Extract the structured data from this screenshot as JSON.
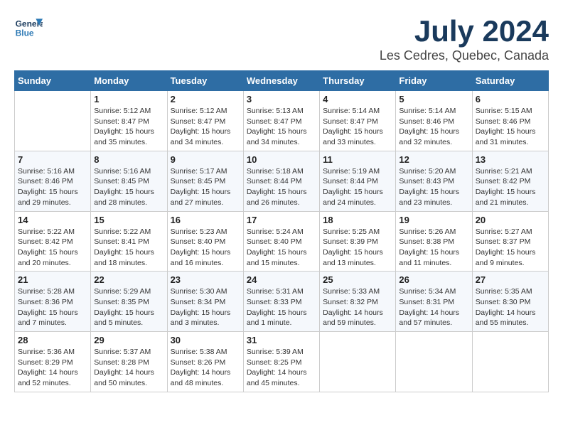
{
  "header": {
    "logo_line1": "General",
    "logo_line2": "Blue",
    "month_title": "July 2024",
    "location": "Les Cedres, Quebec, Canada"
  },
  "days_of_week": [
    "Sunday",
    "Monday",
    "Tuesday",
    "Wednesday",
    "Thursday",
    "Friday",
    "Saturday"
  ],
  "weeks": [
    [
      {
        "day": "",
        "sunrise": "",
        "sunset": "",
        "daylight": ""
      },
      {
        "day": "1",
        "sunrise": "Sunrise: 5:12 AM",
        "sunset": "Sunset: 8:47 PM",
        "daylight": "Daylight: 15 hours and 35 minutes."
      },
      {
        "day": "2",
        "sunrise": "Sunrise: 5:12 AM",
        "sunset": "Sunset: 8:47 PM",
        "daylight": "Daylight: 15 hours and 34 minutes."
      },
      {
        "day": "3",
        "sunrise": "Sunrise: 5:13 AM",
        "sunset": "Sunset: 8:47 PM",
        "daylight": "Daylight: 15 hours and 34 minutes."
      },
      {
        "day": "4",
        "sunrise": "Sunrise: 5:14 AM",
        "sunset": "Sunset: 8:47 PM",
        "daylight": "Daylight: 15 hours and 33 minutes."
      },
      {
        "day": "5",
        "sunrise": "Sunrise: 5:14 AM",
        "sunset": "Sunset: 8:46 PM",
        "daylight": "Daylight: 15 hours and 32 minutes."
      },
      {
        "day": "6",
        "sunrise": "Sunrise: 5:15 AM",
        "sunset": "Sunset: 8:46 PM",
        "daylight": "Daylight: 15 hours and 31 minutes."
      }
    ],
    [
      {
        "day": "7",
        "sunrise": "Sunrise: 5:16 AM",
        "sunset": "Sunset: 8:46 PM",
        "daylight": "Daylight: 15 hours and 29 minutes."
      },
      {
        "day": "8",
        "sunrise": "Sunrise: 5:16 AM",
        "sunset": "Sunset: 8:45 PM",
        "daylight": "Daylight: 15 hours and 28 minutes."
      },
      {
        "day": "9",
        "sunrise": "Sunrise: 5:17 AM",
        "sunset": "Sunset: 8:45 PM",
        "daylight": "Daylight: 15 hours and 27 minutes."
      },
      {
        "day": "10",
        "sunrise": "Sunrise: 5:18 AM",
        "sunset": "Sunset: 8:44 PM",
        "daylight": "Daylight: 15 hours and 26 minutes."
      },
      {
        "day": "11",
        "sunrise": "Sunrise: 5:19 AM",
        "sunset": "Sunset: 8:44 PM",
        "daylight": "Daylight: 15 hours and 24 minutes."
      },
      {
        "day": "12",
        "sunrise": "Sunrise: 5:20 AM",
        "sunset": "Sunset: 8:43 PM",
        "daylight": "Daylight: 15 hours and 23 minutes."
      },
      {
        "day": "13",
        "sunrise": "Sunrise: 5:21 AM",
        "sunset": "Sunset: 8:42 PM",
        "daylight": "Daylight: 15 hours and 21 minutes."
      }
    ],
    [
      {
        "day": "14",
        "sunrise": "Sunrise: 5:22 AM",
        "sunset": "Sunset: 8:42 PM",
        "daylight": "Daylight: 15 hours and 20 minutes."
      },
      {
        "day": "15",
        "sunrise": "Sunrise: 5:22 AM",
        "sunset": "Sunset: 8:41 PM",
        "daylight": "Daylight: 15 hours and 18 minutes."
      },
      {
        "day": "16",
        "sunrise": "Sunrise: 5:23 AM",
        "sunset": "Sunset: 8:40 PM",
        "daylight": "Daylight: 15 hours and 16 minutes."
      },
      {
        "day": "17",
        "sunrise": "Sunrise: 5:24 AM",
        "sunset": "Sunset: 8:40 PM",
        "daylight": "Daylight: 15 hours and 15 minutes."
      },
      {
        "day": "18",
        "sunrise": "Sunrise: 5:25 AM",
        "sunset": "Sunset: 8:39 PM",
        "daylight": "Daylight: 15 hours and 13 minutes."
      },
      {
        "day": "19",
        "sunrise": "Sunrise: 5:26 AM",
        "sunset": "Sunset: 8:38 PM",
        "daylight": "Daylight: 15 hours and 11 minutes."
      },
      {
        "day": "20",
        "sunrise": "Sunrise: 5:27 AM",
        "sunset": "Sunset: 8:37 PM",
        "daylight": "Daylight: 15 hours and 9 minutes."
      }
    ],
    [
      {
        "day": "21",
        "sunrise": "Sunrise: 5:28 AM",
        "sunset": "Sunset: 8:36 PM",
        "daylight": "Daylight: 15 hours and 7 minutes."
      },
      {
        "day": "22",
        "sunrise": "Sunrise: 5:29 AM",
        "sunset": "Sunset: 8:35 PM",
        "daylight": "Daylight: 15 hours and 5 minutes."
      },
      {
        "day": "23",
        "sunrise": "Sunrise: 5:30 AM",
        "sunset": "Sunset: 8:34 PM",
        "daylight": "Daylight: 15 hours and 3 minutes."
      },
      {
        "day": "24",
        "sunrise": "Sunrise: 5:31 AM",
        "sunset": "Sunset: 8:33 PM",
        "daylight": "Daylight: 15 hours and 1 minute."
      },
      {
        "day": "25",
        "sunrise": "Sunrise: 5:33 AM",
        "sunset": "Sunset: 8:32 PM",
        "daylight": "Daylight: 14 hours and 59 minutes."
      },
      {
        "day": "26",
        "sunrise": "Sunrise: 5:34 AM",
        "sunset": "Sunset: 8:31 PM",
        "daylight": "Daylight: 14 hours and 57 minutes."
      },
      {
        "day": "27",
        "sunrise": "Sunrise: 5:35 AM",
        "sunset": "Sunset: 8:30 PM",
        "daylight": "Daylight: 14 hours and 55 minutes."
      }
    ],
    [
      {
        "day": "28",
        "sunrise": "Sunrise: 5:36 AM",
        "sunset": "Sunset: 8:29 PM",
        "daylight": "Daylight: 14 hours and 52 minutes."
      },
      {
        "day": "29",
        "sunrise": "Sunrise: 5:37 AM",
        "sunset": "Sunset: 8:28 PM",
        "daylight": "Daylight: 14 hours and 50 minutes."
      },
      {
        "day": "30",
        "sunrise": "Sunrise: 5:38 AM",
        "sunset": "Sunset: 8:26 PM",
        "daylight": "Daylight: 14 hours and 48 minutes."
      },
      {
        "day": "31",
        "sunrise": "Sunrise: 5:39 AM",
        "sunset": "Sunset: 8:25 PM",
        "daylight": "Daylight: 14 hours and 45 minutes."
      },
      {
        "day": "",
        "sunrise": "",
        "sunset": "",
        "daylight": ""
      },
      {
        "day": "",
        "sunrise": "",
        "sunset": "",
        "daylight": ""
      },
      {
        "day": "",
        "sunrise": "",
        "sunset": "",
        "daylight": ""
      }
    ]
  ]
}
